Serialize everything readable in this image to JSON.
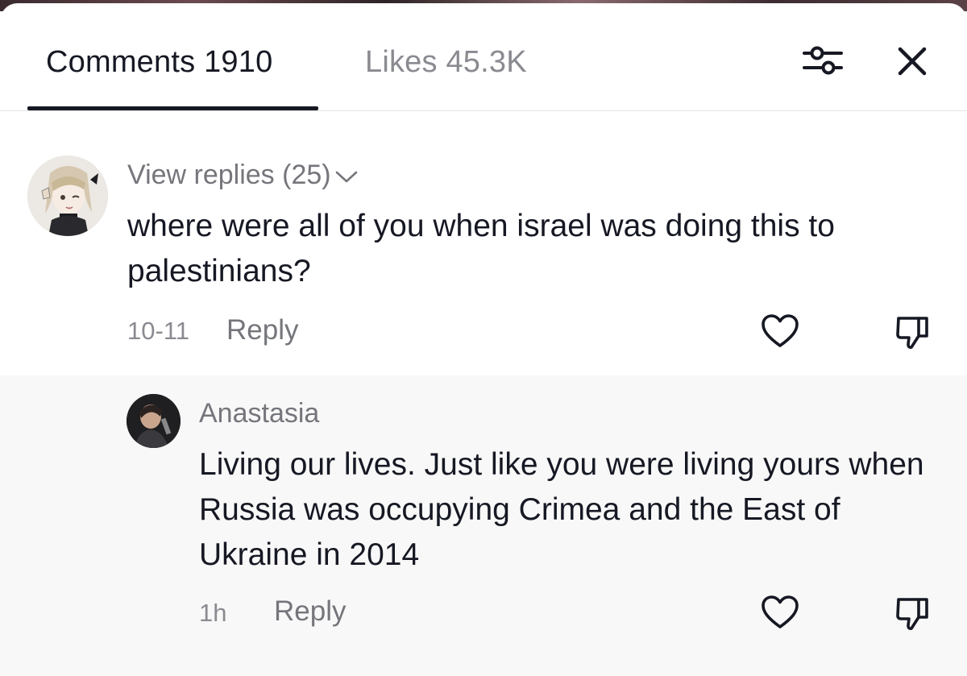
{
  "header": {
    "tab_comments": "Comments 1910",
    "tab_likes": "Likes 45.3K",
    "filter_icon": "sliders-icon",
    "close_icon": "close-icon"
  },
  "comments": [
    {
      "view_replies": "View replies (25)",
      "text": "where were all of you when israel was doing this to palestinians?",
      "date": "10-11",
      "reply_label": "Reply",
      "avatar": "anime-girl-avatar"
    }
  ],
  "replies": [
    {
      "username": "Anastasia",
      "text": "Living our lives. Just like you were living yours when Russia was occupying Crimea and the East of Ukraine in 2014",
      "date": "1h",
      "reply_label": "Reply",
      "avatar": "profile-photo-avatar"
    }
  ],
  "colors": {
    "primary_text": "#161823",
    "secondary_text": "#75767c",
    "reply_background": "#f8f8f8",
    "divider": "#e3e3e4"
  }
}
